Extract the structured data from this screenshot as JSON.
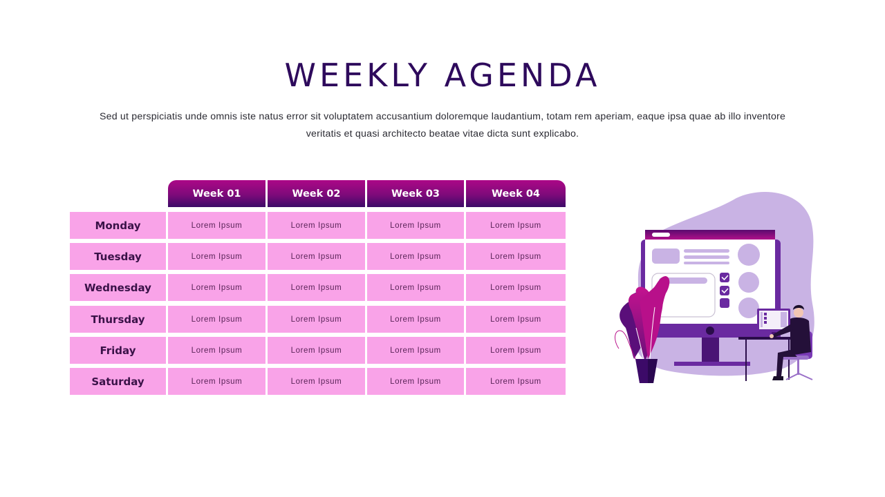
{
  "slide": {
    "title": "WEEKLY AGENDA",
    "description": "Sed ut perspiciatis unde omnis iste natus error sit voluptatem accusantium doloremque laudantium, totam rem aperiam, eaque ipsa quae ab illo inventore veritatis et quasi architecto beatae vitae dicta sunt explicabo."
  },
  "agenda": {
    "weeks": [
      "Week 01",
      "Week 02",
      "Week 03",
      "Week 04"
    ],
    "rows": [
      {
        "day": "Monday",
        "entries": [
          "Lorem Ipsum",
          "Lorem Ipsum",
          "Lorem Ipsum",
          "Lorem Ipsum"
        ]
      },
      {
        "day": "Tuesday",
        "entries": [
          "Lorem Ipsum",
          "Lorem Ipsum",
          "Lorem Ipsum",
          "Lorem Ipsum"
        ]
      },
      {
        "day": "Wednesday",
        "entries": [
          "Lorem Ipsum",
          "Lorem Ipsum",
          "Lorem Ipsum",
          "Lorem Ipsum"
        ]
      },
      {
        "day": "Thursday",
        "entries": [
          "Lorem Ipsum",
          "Lorem Ipsum",
          "Lorem Ipsum",
          "Lorem Ipsum"
        ]
      },
      {
        "day": "Friday",
        "entries": [
          "Lorem Ipsum",
          "Lorem Ipsum",
          "Lorem Ipsum",
          "Lorem Ipsum"
        ]
      },
      {
        "day": "Saturday",
        "entries": [
          "Lorem Ipsum",
          "Lorem Ipsum",
          "Lorem Ipsum",
          "Lorem Ipsum"
        ]
      }
    ]
  },
  "colors": {
    "title": "#2e0a5c",
    "cell_pink": "#f9a3e8",
    "header_top": "#ac0887",
    "header_bottom": "#3c0a68",
    "blob_lavender": "#c9b3e4",
    "monitor_purple": "#6a2aa0"
  },
  "illustration": {
    "subject": "person-at-computer-with-checklist",
    "icons": [
      "blob-background-icon",
      "monitor-icon",
      "checkbox-checked-icon",
      "checkbox-checked-icon",
      "checkbox-empty-icon",
      "plant-icon",
      "person-icon",
      "desk-icon",
      "chair-icon",
      "laptop-icon"
    ]
  }
}
